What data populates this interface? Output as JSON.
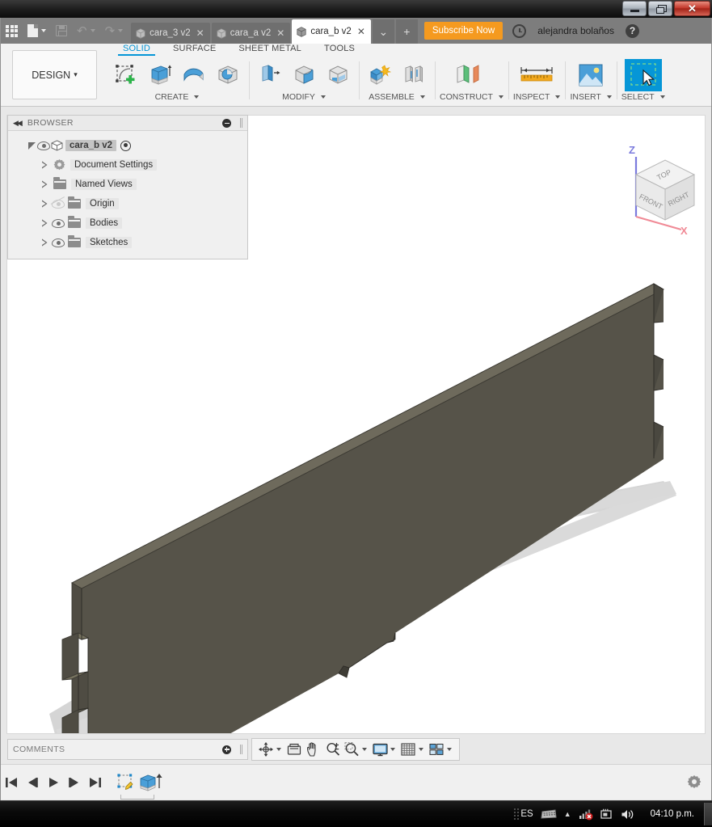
{
  "window": {
    "controls": [
      {
        "name": "minimize",
        "label": "—"
      },
      {
        "name": "restore",
        "label": "❐"
      },
      {
        "name": "close",
        "label": "✕"
      }
    ]
  },
  "appbar": {
    "grid_icon": "app-grid-icon",
    "file_icon": "file-icon",
    "save_icon": "save-icon",
    "undo_icon": "undo-icon",
    "redo_icon": "redo-icon",
    "tabs": [
      {
        "label": "cara_3 v2",
        "active": false,
        "close": "✕"
      },
      {
        "label": "cara_a v2",
        "active": false,
        "close": "✕"
      },
      {
        "label": "cara_b v2",
        "active": true,
        "close": "✕"
      }
    ],
    "tab_overflow": "⌄",
    "tab_new": "+",
    "subscribe_label": "Subscribe Now",
    "subscribe_color": "#f59a1f",
    "clock_icon": "clock-icon",
    "username": "alejandra bolaños",
    "help_label": "?"
  },
  "ribbon": {
    "workspace": "DESIGN",
    "workspace_caret": "▾",
    "accent_color": "#0696d7",
    "tabs": [
      {
        "label": "SOLID",
        "active": true
      },
      {
        "label": "SURFACE",
        "active": false
      },
      {
        "label": "SHEET METAL",
        "active": false
      },
      {
        "label": "TOOLS",
        "active": false
      }
    ],
    "panels": [
      {
        "label": "CREATE",
        "caret": "▾",
        "icons": [
          "create-sketch-icon",
          "extrude-icon",
          "revolve-icon",
          "sweep-icon"
        ]
      },
      {
        "label": "MODIFY",
        "caret": "▾",
        "icons": [
          "press-pull-icon",
          "fillet-icon",
          "shell-icon"
        ]
      },
      {
        "label": "ASSEMBLE",
        "caret": "▾",
        "icons": [
          "new-component-icon",
          "joint-icon"
        ]
      },
      {
        "label": "CONSTRUCT",
        "caret": "▾",
        "icons": [
          "offset-plane-icon"
        ]
      },
      {
        "label": "INSPECT",
        "caret": "▾",
        "icons": [
          "measure-icon"
        ]
      },
      {
        "label": "INSERT",
        "caret": "▾",
        "icons": [
          "insert-image-icon"
        ]
      },
      {
        "label": "SELECT",
        "caret": "▾",
        "icons": [
          "select-window-icon"
        ],
        "selected": true
      }
    ]
  },
  "browser": {
    "title": "BROWSER",
    "collapse_icon": "collapse-left-icon",
    "minimize_icon": "minus-circle-icon",
    "tree": [
      {
        "label": "cara_b v2",
        "level": 0,
        "expander": "triangle-down-filled",
        "eye": "on",
        "icon": "document-cube-icon",
        "trailing": "target-dot-icon"
      },
      {
        "label": "Document Settings",
        "level": 1,
        "expander": "triangle-right",
        "eye": "none",
        "icon": "gear-icon"
      },
      {
        "label": "Named Views",
        "level": 1,
        "expander": "triangle-right",
        "eye": "none",
        "icon": "folder-icon"
      },
      {
        "label": "Origin",
        "level": 1,
        "expander": "triangle-right",
        "eye": "off",
        "icon": "folder-icon"
      },
      {
        "label": "Bodies",
        "level": 1,
        "expander": "triangle-right",
        "eye": "on",
        "icon": "folder-icon"
      },
      {
        "label": "Sketches",
        "level": 1,
        "expander": "triangle-right",
        "eye": "on",
        "icon": "folder-icon"
      }
    ]
  },
  "canvas": {
    "background_color": "#ffffff",
    "model": {
      "name": "cara_b-panel-body",
      "face_color": "#565349",
      "top_color": "#6e6a5c",
      "side_color": "#4a473f",
      "shadow_color": "#d5d5d5",
      "description": "Isometric extruded rectangular panel with finger-joint notches on left, right and bottom edges"
    },
    "viewcube": {
      "faces": [
        "TOP",
        "FRONT",
        "RIGHT"
      ],
      "axes": [
        {
          "label": "Z",
          "color": "#7b7bdd"
        },
        {
          "label": "X",
          "color": "#f08a96"
        }
      ]
    }
  },
  "comments": {
    "title": "COMMENTS",
    "add_icon": "plus-circle-icon"
  },
  "navbar": {
    "items": [
      {
        "name": "orbit-icon",
        "caret": true
      },
      {
        "name": "look-at-icon",
        "caret": false
      },
      {
        "name": "pan-icon",
        "caret": false
      },
      {
        "name": "zoom-icon",
        "caret": false
      },
      {
        "name": "zoom-window-icon",
        "caret": true
      },
      {
        "name": "display-settings-icon",
        "caret": true
      },
      {
        "name": "grid-snaps-icon",
        "caret": true
      },
      {
        "name": "viewports-icon",
        "caret": true
      }
    ]
  },
  "timeline": {
    "controls": [
      {
        "name": "go-to-beginning-button",
        "glyph": "|◀"
      },
      {
        "name": "step-back-button",
        "glyph": "◀|"
      },
      {
        "name": "play-button",
        "glyph": "▶"
      },
      {
        "name": "step-forward-button",
        "glyph": "|▶"
      },
      {
        "name": "go-to-end-button",
        "glyph": "▶|"
      }
    ],
    "features": [
      {
        "name": "sketch-feature",
        "label": "sketch-icon"
      },
      {
        "name": "extrude-feature",
        "label": "extrude-icon"
      }
    ],
    "settings_icon": "gear-icon"
  },
  "taskbar": {
    "language": "ES",
    "keyboard_icon": "keyboard-icon",
    "show_hidden_icon": "▲",
    "network_icon": "network-error-icon",
    "action_center_icon": "action-center-icon",
    "volume_icon": "volume-icon",
    "time": "04:10 p.m."
  }
}
